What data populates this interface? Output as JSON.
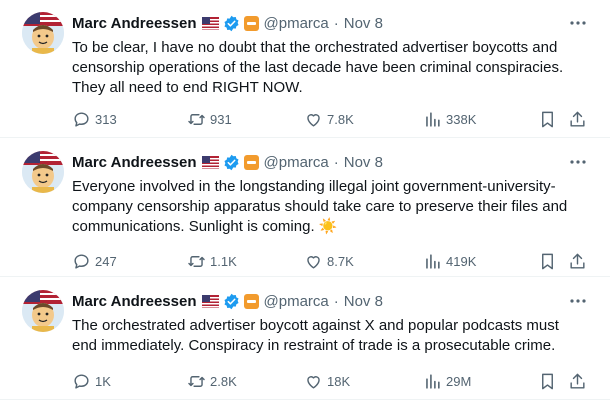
{
  "tweets": [
    {
      "author": {
        "name": "Marc Andreessen",
        "handle": "@pmarca",
        "time": "Nov 8"
      },
      "lines": [
        "To be clear, I have no doubt that the orchestrated advertiser boycotts and",
        "censorship operations of the last decade have been criminal conspiracies.",
        "They all need to end RIGHT NOW."
      ],
      "stats": {
        "replies": "313",
        "reposts": "931",
        "likes": "7.8K",
        "views": "338K"
      }
    },
    {
      "author": {
        "name": "Marc Andreessen",
        "handle": "@pmarca",
        "time": "Nov 8"
      },
      "lines": [
        "Everyone involved in the longstanding illegal joint government-university-",
        "company censorship apparatus should take care to preserve their files and",
        "communications. Sunlight is coming. ☀️"
      ],
      "stats": {
        "replies": "247",
        "reposts": "1.1K",
        "likes": "8.7K",
        "views": "419K"
      }
    },
    {
      "author": {
        "name": "Marc Andreessen",
        "handle": "@pmarca",
        "time": "Nov 8"
      },
      "lines": [
        "The orchestrated advertiser boycott against X and popular podcasts must",
        "end immediately. Conspiracy in restraint of trade is a prosecutable crime."
      ],
      "stats": {
        "replies": "1K",
        "reposts": "2.8K",
        "likes": "18K",
        "views": "29M"
      }
    }
  ],
  "separator": "·",
  "icons": [
    "more-icon",
    "reply-icon",
    "retweet-icon",
    "like-icon",
    "views-icon",
    "bookmark-icon",
    "share-icon",
    "verified-icon",
    "us-flag-icon",
    "affiliate-badge-icon"
  ],
  "colors": {
    "text": "#0f1419",
    "secondary": "#536471",
    "verified": "#1d9bf0",
    "affiliate": "#f29b2d",
    "divider": "#eff3f4"
  }
}
